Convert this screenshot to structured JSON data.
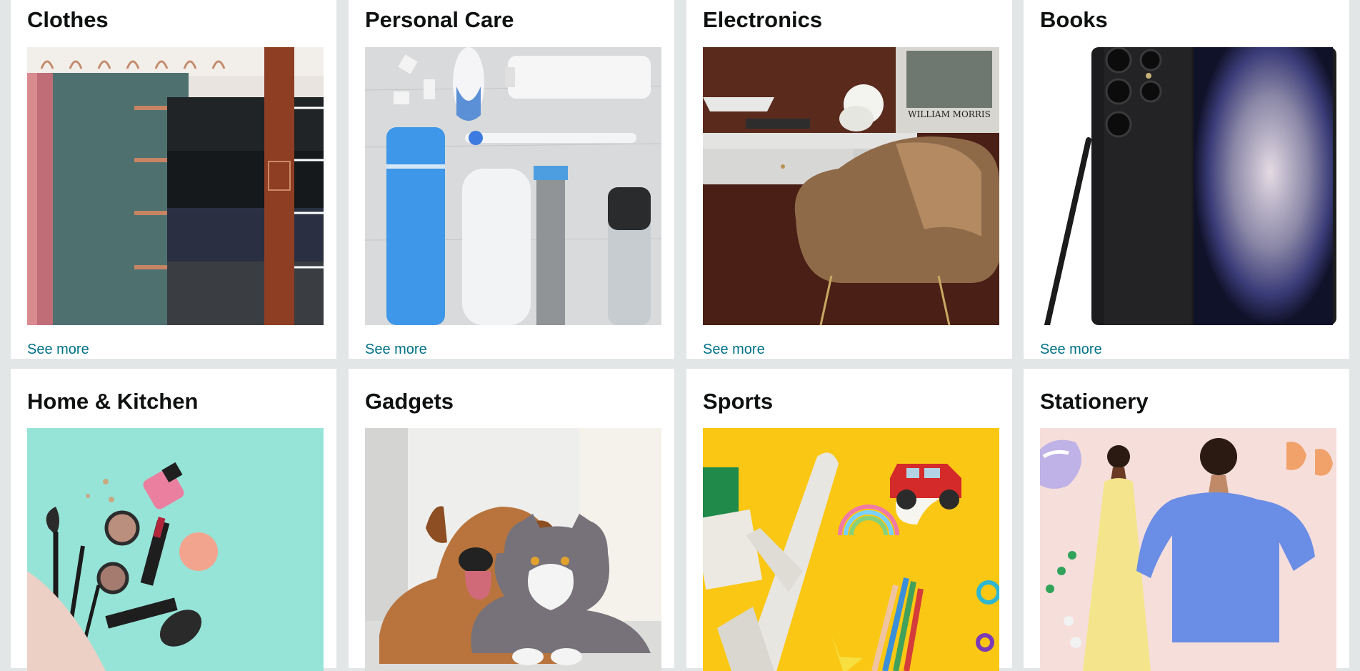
{
  "cards": [
    {
      "title": "Clothes",
      "see_more": "See more",
      "image": "clothes-hanger-photo"
    },
    {
      "title": "Personal Care",
      "see_more": "See more",
      "image": "personal-care-products-photo"
    },
    {
      "title": "Electronics",
      "see_more": "See more",
      "image": "desk-and-chair-photo"
    },
    {
      "title": "Books",
      "see_more": "See more",
      "image": "smartphone-with-stylus-photo"
    },
    {
      "title": "Home & Kitchen",
      "image": "makeup-brushes-photo"
    },
    {
      "title": "Gadgets",
      "image": "dog-and-cat-photo"
    },
    {
      "title": "Sports",
      "image": "toy-plane-and-car-photo"
    },
    {
      "title": "Stationery",
      "image": "fashion-models-photo"
    }
  ],
  "colors": {
    "page_background": "#e3e6e6",
    "card_background": "#ffffff",
    "title_text": "#0f1111",
    "link": "#007185"
  }
}
